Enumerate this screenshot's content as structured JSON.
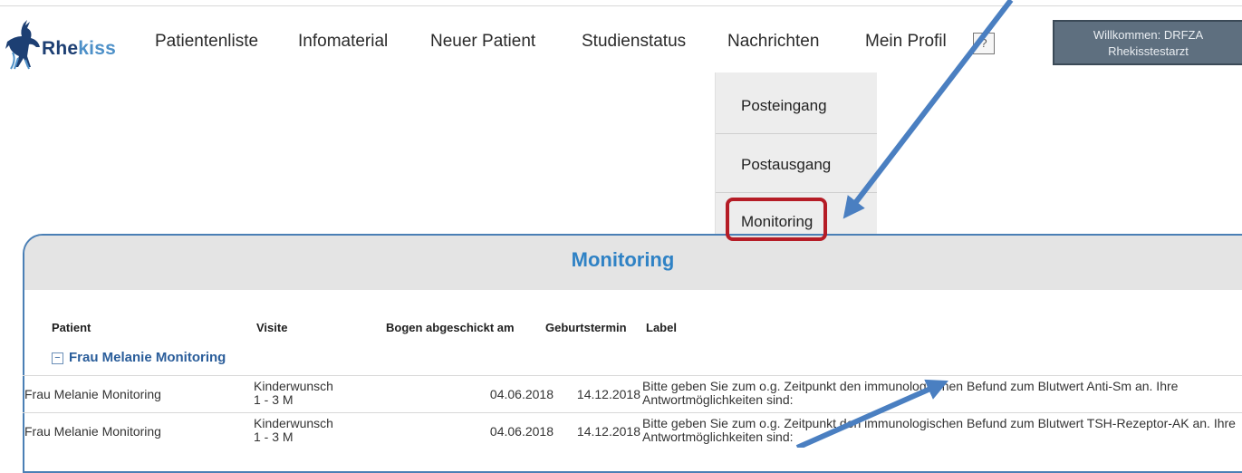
{
  "logo": {
    "text_part1": "Rhe",
    "text_part2": "kiss"
  },
  "nav": {
    "items": [
      {
        "label": "Patientenliste"
      },
      {
        "label": "Infomaterial"
      },
      {
        "label": "Neuer Patient"
      },
      {
        "label": "Studienstatus"
      },
      {
        "label": "Nachrichten"
      },
      {
        "label": "Mein Profil"
      }
    ],
    "help": "?"
  },
  "welcome": {
    "line1": "Willkommen: DRFZA",
    "line2": "Rhekisstestarzt"
  },
  "dropdown": {
    "items": [
      {
        "label": "Posteingang"
      },
      {
        "label": "Postausgang"
      },
      {
        "label": "Monitoring",
        "highlighted": true
      }
    ]
  },
  "panel": {
    "title": "Monitoring",
    "columns": {
      "patient": "Patient",
      "visite": "Visite",
      "sent": "Bogen abgeschickt am",
      "birth": "Geburtstermin",
      "label": "Label"
    },
    "group": {
      "toggle": "−",
      "name": "Frau Melanie Monitoring"
    },
    "rows": [
      {
        "patient": "Frau Melanie Monitoring",
        "visite_line1": "Kinderwunsch",
        "visite_line2": "1 - 3 M",
        "sent": "04.06.2018",
        "birth": "14.12.2018",
        "label": "Bitte geben Sie zum o.g. Zeitpunkt den immunologischen Befund zum Blutwert Anti-Sm an. Ihre Antwortmöglichkeiten sind:"
      },
      {
        "patient": "Frau Melanie Monitoring",
        "visite_line1": "Kinderwunsch",
        "visite_line2": "1 - 3 M",
        "sent": "04.06.2018",
        "birth": "14.12.2018",
        "label": "Bitte geben Sie zum o.g. Zeitpunkt den immunologischen Befund zum Blutwert TSH-Rezeptor-AK an. Ihre Antwortmöglichkeiten sind:"
      }
    ]
  },
  "colors": {
    "accent": "#2f82c5",
    "highlight": "#b51c26",
    "arrow": "#4a7fc1",
    "header_bg": "#5e6f7f"
  }
}
